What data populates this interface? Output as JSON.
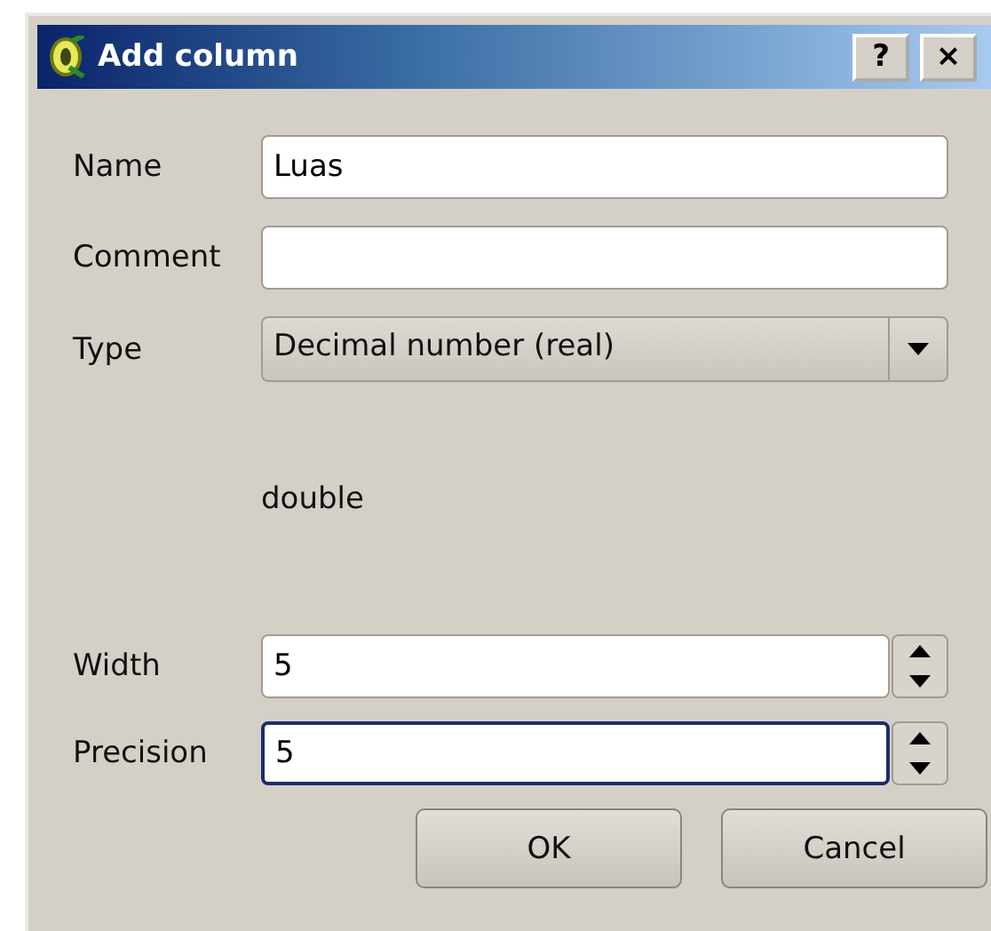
{
  "window": {
    "title": "Add column",
    "title_buttons": [
      "?",
      "×"
    ]
  },
  "fields": [
    {
      "kind": "text",
      "label": "Name",
      "value": "Luas",
      "focused": false
    },
    {
      "kind": "text",
      "label": "Comment",
      "focused": false
    },
    {
      "kind": "select",
      "label": "Type",
      "value": "Decimal number (real)",
      "focused": false
    }
  ],
  "type_note": "double",
  "spin_fields": [
    {
      "kind": "spin",
      "label": "Width",
      "value": "5",
      "focused": false
    },
    {
      "kind": "spin",
      "label": "Precision",
      "value": "5",
      "focused": true
    }
  ],
  "buttons": [
    "OK",
    "Cancel"
  ]
}
